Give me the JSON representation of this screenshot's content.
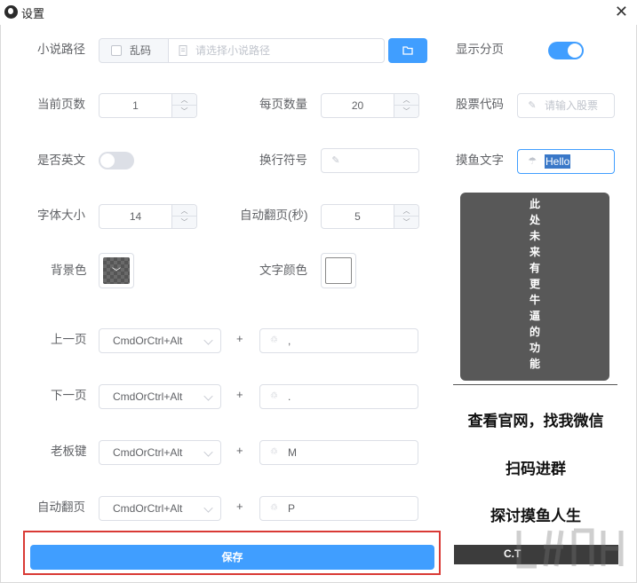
{
  "window": {
    "title": "设置",
    "close_glyph": "✕"
  },
  "novel_path": {
    "label": "小说路径",
    "garbled_label": "乱码",
    "path_placeholder": "请选择小说路径"
  },
  "show_pagination": {
    "label": "显示分页",
    "on": true
  },
  "current_page": {
    "label": "当前页数",
    "value": "1"
  },
  "per_page": {
    "label": "每页数量",
    "value": "20"
  },
  "stock_code": {
    "label": "股票代码",
    "placeholder": "请输入股票"
  },
  "is_english": {
    "label": "是否英文",
    "on": false
  },
  "line_break": {
    "label": "换行符号",
    "value": ""
  },
  "fish_text": {
    "label": "摸鱼文字",
    "value": "Hello"
  },
  "font_size": {
    "label": "字体大小",
    "value": "14"
  },
  "auto_page": {
    "label": "自动翻页(秒)",
    "value": "5"
  },
  "bg_color": {
    "label": "背景色"
  },
  "text_color": {
    "label": "文字颜色"
  },
  "shortcuts": [
    {
      "label": "上一页",
      "modifier": "CmdOrCtrl+Alt",
      "key": ","
    },
    {
      "label": "下一页",
      "modifier": "CmdOrCtrl+Alt",
      "key": "."
    },
    {
      "label": "老板键",
      "modifier": "CmdOrCtrl+Alt",
      "key": "M"
    },
    {
      "label": "自动翻页",
      "modifier": "CmdOrCtrl+Alt",
      "key": "P"
    }
  ],
  "plus_sign": "+",
  "future_panel": {
    "text": "此处未来有更牛逼的功能"
  },
  "promo": {
    "line1": "查看官网，找我微信",
    "line2": "扫码进群",
    "line3": "探讨摸鱼人生"
  },
  "dark_strip_text": "C.T",
  "save_label": "保存",
  "colors": {
    "accent": "#409eff",
    "highlight": "#d93a35"
  }
}
